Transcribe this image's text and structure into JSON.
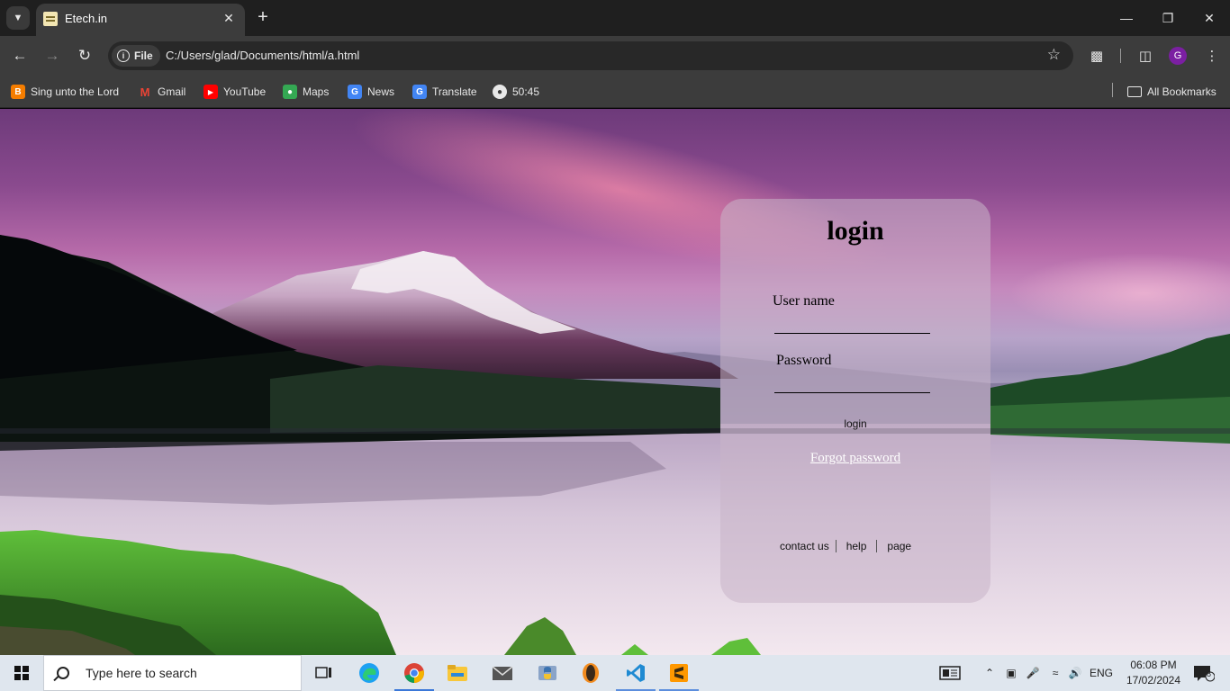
{
  "browser": {
    "tab": {
      "title": "Etech.in"
    },
    "omnibox": {
      "scheme_label": "File",
      "url": "C:/Users/glad/Documents/html/a.html"
    },
    "profile_initial": "G",
    "bookmarks": [
      {
        "label": "Sing unto the Lord",
        "icon": "blogger-icon",
        "color": "#f57d00"
      },
      {
        "label": "Gmail",
        "icon": "gmail-icon",
        "color": "#ea4335"
      },
      {
        "label": "YouTube",
        "icon": "youtube-icon",
        "color": "#ff0000"
      },
      {
        "label": "Maps",
        "icon": "maps-icon",
        "color": "#34a853"
      },
      {
        "label": "News",
        "icon": "news-icon",
        "color": "#4285f4"
      },
      {
        "label": "Translate",
        "icon": "translate-icon",
        "color": "#4285f4"
      },
      {
        "label": "50:45",
        "icon": "globe-icon",
        "color": "#e8e8e8"
      }
    ],
    "all_bookmarks_label": "All Bookmarks"
  },
  "page": {
    "login": {
      "title": "login",
      "username_label": "User name",
      "password_label": "Password",
      "login_button": "login",
      "forgot_link": "Forgot password",
      "footer_links": [
        "contact us",
        "help",
        "page"
      ]
    }
  },
  "taskbar": {
    "search_placeholder": "Type here to search",
    "apps": [
      "task-view",
      "edge",
      "chrome",
      "file-explorer",
      "mail",
      "python-idle",
      "fl-studio",
      "vscode",
      "sublime-text"
    ],
    "tray": {
      "language": "ENG",
      "time": "06:08 PM",
      "date": "17/02/2024",
      "notifications": "8"
    }
  },
  "colors": {
    "chrome_dark": "#1f1f1f",
    "chrome_toolbar": "#3c3c3c",
    "card_bg": "rgba(200,180,200,0.55)",
    "taskbar": "#dfe6ee"
  }
}
